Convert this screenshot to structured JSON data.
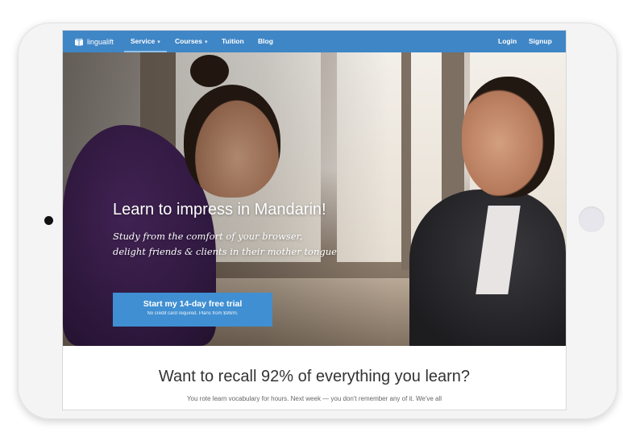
{
  "navbar": {
    "logo_text": "lingualift",
    "items": [
      {
        "label": "Service",
        "has_dropdown": true,
        "active": true
      },
      {
        "label": "Courses",
        "has_dropdown": true,
        "active": false
      },
      {
        "label": "Tuition",
        "has_dropdown": false,
        "active": false
      },
      {
        "label": "Blog",
        "has_dropdown": false,
        "active": false
      }
    ],
    "login_label": "Login",
    "signup_label": "Signup",
    "caret": "▾",
    "bar_color": "#3f86c6"
  },
  "hero": {
    "title": "Learn to impress in Mandarin!",
    "subtitle_line1": "Study from the comfort of your browser,",
    "subtitle_line2": "delight friends & clients in their mother tongue",
    "cta_label": "Start my 14-day free trial",
    "cta_note": "No credit card required. Plans from $99/m.",
    "cta_color": "#3f8fd2"
  },
  "section": {
    "title": "Want to recall 92% of everything you learn?",
    "text": "You rote learn vocabulary for hours. Next week — you don't remember any of it. We've all"
  }
}
